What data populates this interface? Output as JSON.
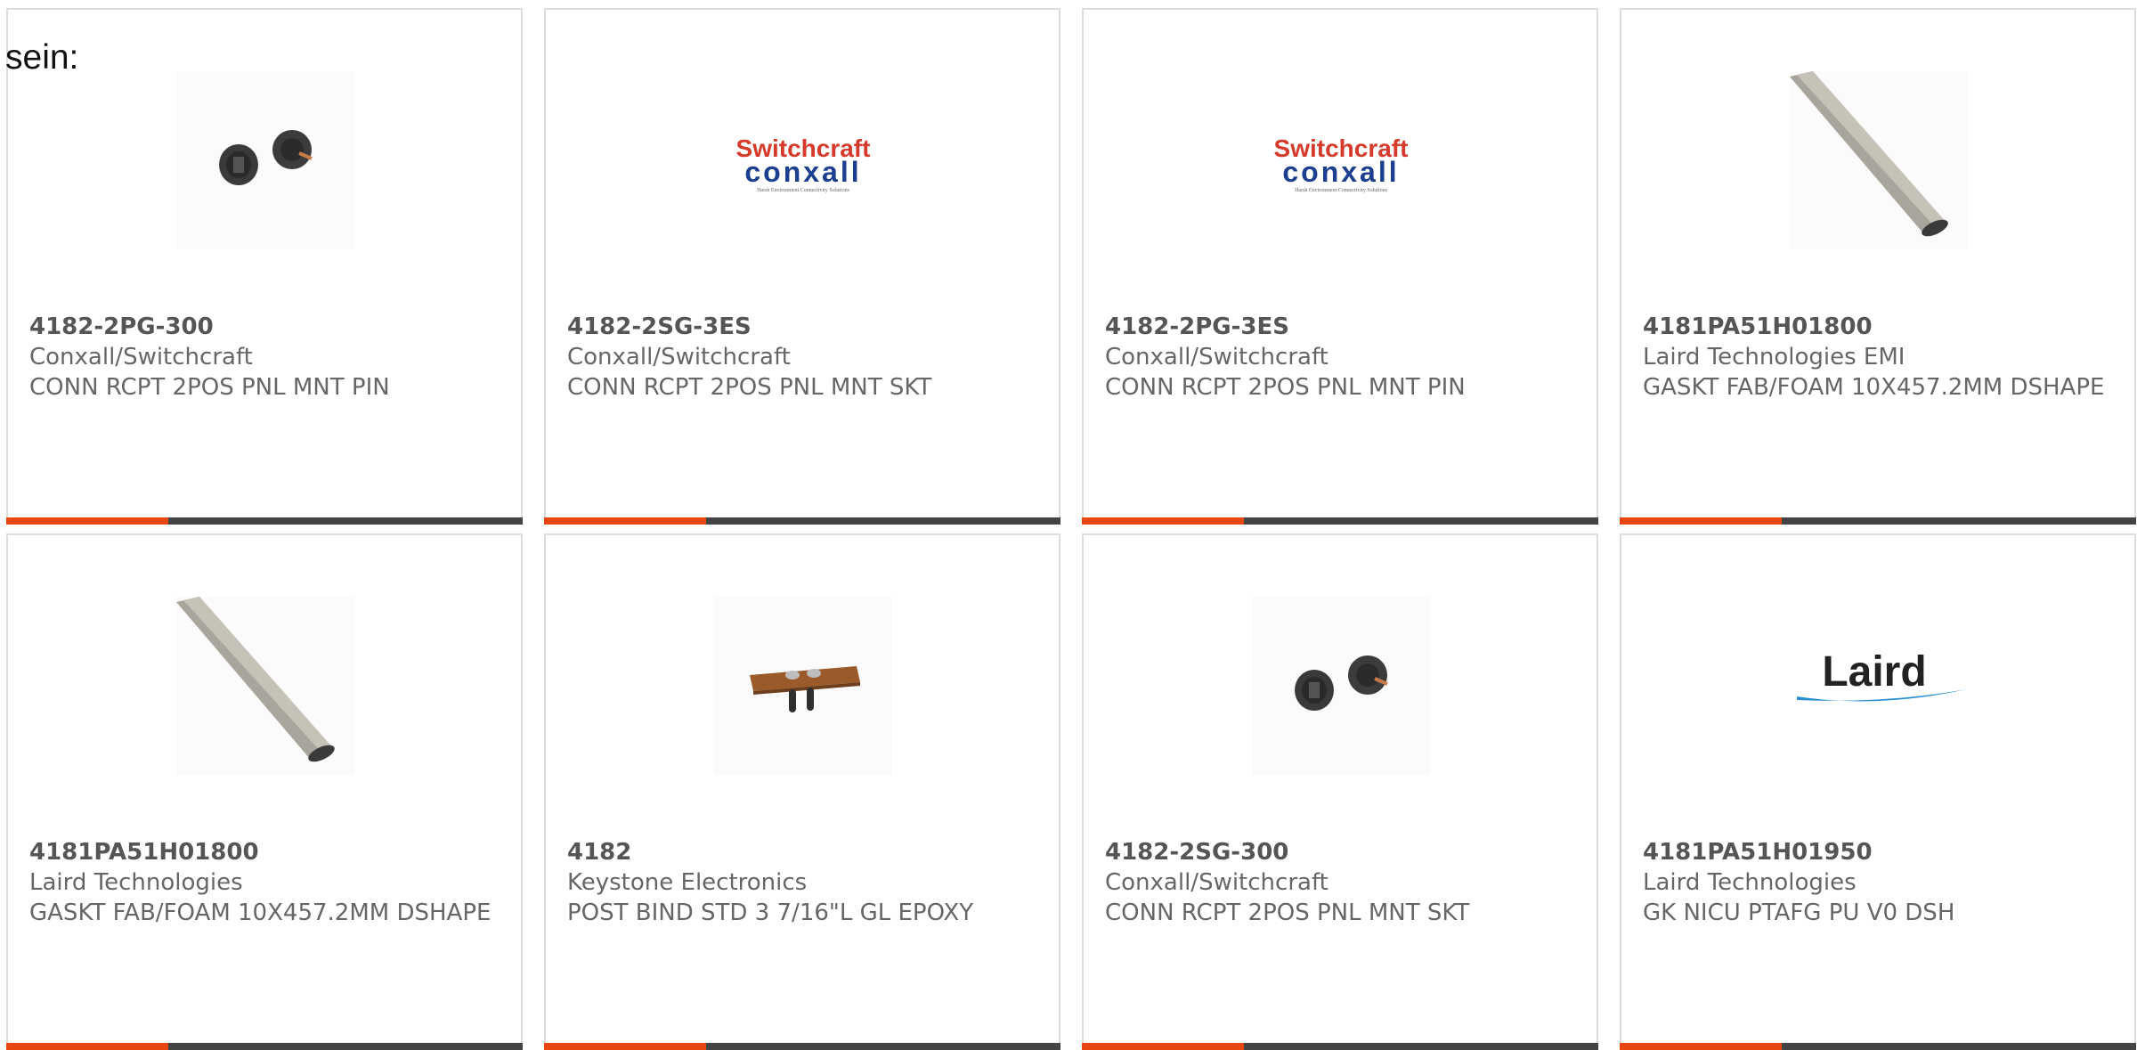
{
  "heading": "sein:",
  "accent_color": "#e8470f",
  "bar_color": "#444444",
  "products": [
    {
      "part": "4182-2PG-300",
      "manufacturer": "Conxall/Switchcraft",
      "description": "CONN RCPT 2POS PNL MNT PIN",
      "image": "connector-pair-image"
    },
    {
      "part": "4182-2SG-3ES",
      "manufacturer": "Conxall/Switchcraft",
      "description": "CONN RCPT 2POS PNL MNT SKT",
      "image": "switchcraft-conxall-logo",
      "logo": {
        "line1": "Switchcraft",
        "line2": "conxall",
        "tagline": "Harsh Environment Connectivity Solutions"
      }
    },
    {
      "part": "4182-2PG-3ES",
      "manufacturer": "Conxall/Switchcraft",
      "description": "CONN RCPT 2POS PNL MNT PIN",
      "image": "switchcraft-conxall-logo",
      "logo": {
        "line1": "Switchcraft",
        "line2": "conxall",
        "tagline": "Harsh Environment Connectivity Solutions"
      }
    },
    {
      "part": "4181PA51H01800",
      "manufacturer": "Laird Technologies EMI",
      "description": "GASKT FAB/FOAM 10X457.2MM DSHAPE",
      "image": "gasket-strip-image"
    },
    {
      "part": "4181PA51H01800",
      "manufacturer": "Laird Technologies",
      "description": "GASKT FAB/FOAM 10X457.2MM DSHAPE",
      "image": "gasket-strip-image"
    },
    {
      "part": "4182",
      "manufacturer": "Keystone Electronics",
      "description": "POST BIND STD 3 7/16\"L GL EPOXY",
      "image": "binding-post-image"
    },
    {
      "part": "4182-2SG-300",
      "manufacturer": "Conxall/Switchcraft",
      "description": "CONN RCPT 2POS PNL MNT SKT",
      "image": "connector-pair-image"
    },
    {
      "part": "4181PA51H01950",
      "manufacturer": "Laird Technologies",
      "description": "GK NICU PTAFG PU V0 DSH",
      "image": "laird-logo",
      "logo": {
        "text": "Laird"
      }
    }
  ]
}
